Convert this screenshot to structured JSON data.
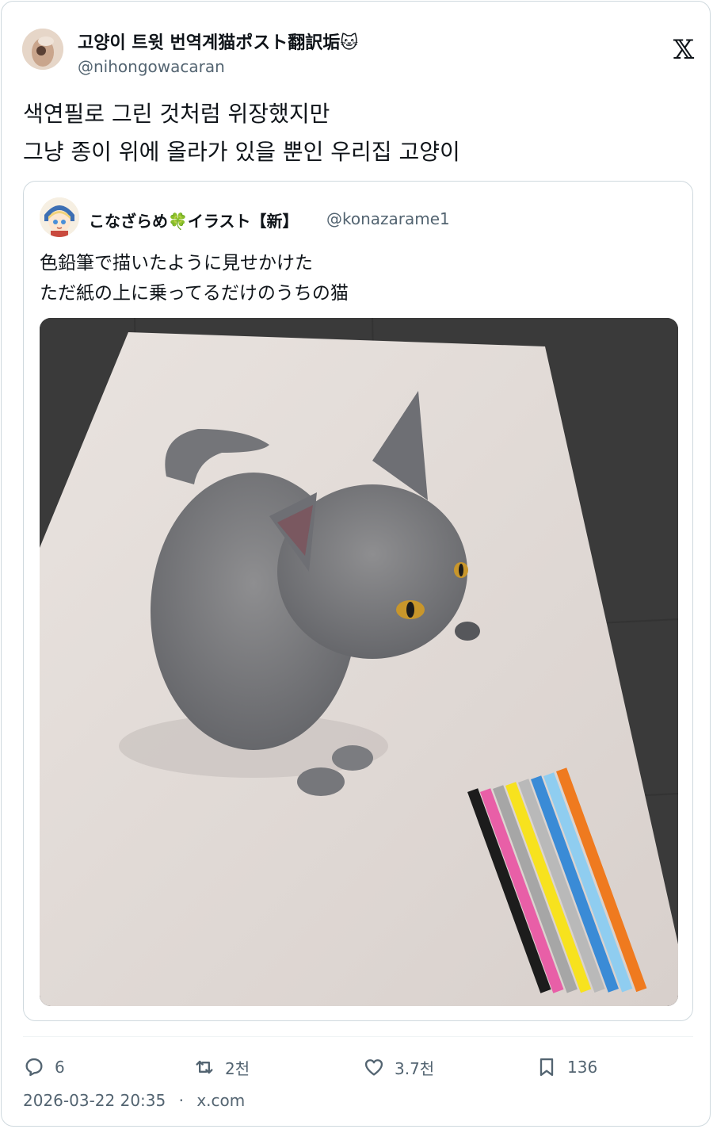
{
  "tweet": {
    "author": {
      "name": "고양이 트윗 번역계猫ポスト翻訳垢🐱",
      "handle": "@nihongowacaran"
    },
    "text_lines": [
      "색연필로 그린 것처럼 위장했지만",
      "그냥 종이 위에 올라가 있을 뿐인 우리집 고양이"
    ],
    "quoted": {
      "author_name": "こなざらめ🍀イラスト【新】",
      "handle": "@konazarame1",
      "text_lines": [
        "色鉛筆で描いたように見せかけた",
        "ただ紙の上に乗ってるだけのうちの猫"
      ]
    },
    "actions": {
      "replies": "6",
      "retweets": "2천",
      "likes": "3.7천",
      "bookmarks": "136"
    },
    "meta": {
      "timestamp": "2026-03-22 20:35",
      "separator": "·",
      "source": "x.com"
    },
    "platform_logo": "𝕏"
  },
  "icons": {
    "reply": "speech-bubble-icon",
    "retweet": "retweet-arrows-icon",
    "like": "heart-icon",
    "bookmark": "bookmark-icon",
    "x": "x-logo-icon"
  }
}
